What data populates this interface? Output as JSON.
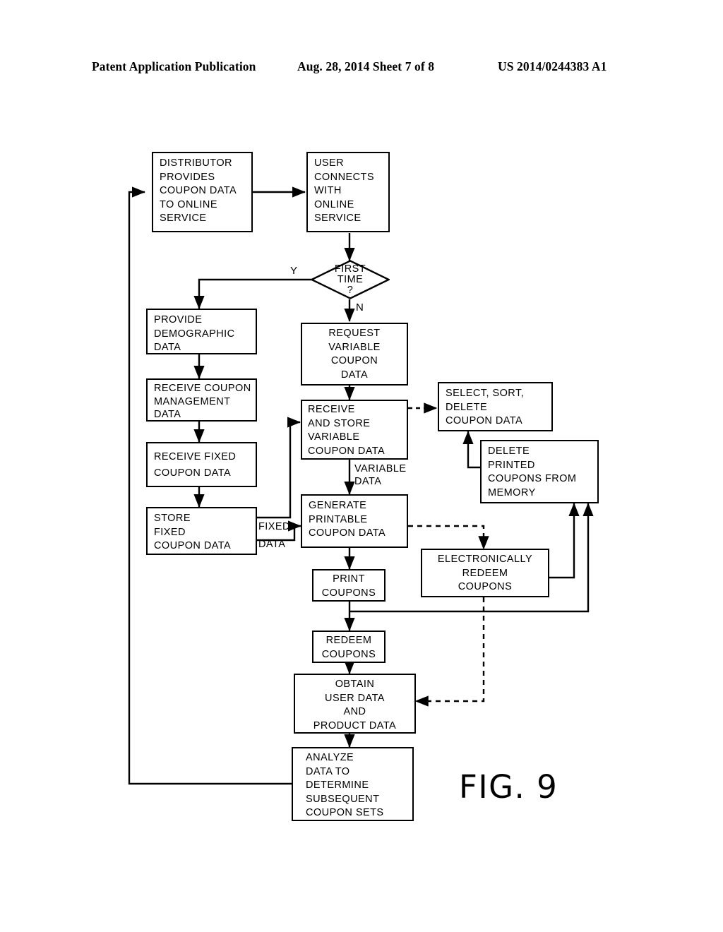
{
  "header": {
    "publication": "Patent Application Publication",
    "date_sheet": "Aug. 28, 2014  Sheet 7 of 8",
    "patent_number": "US 2014/0244383 A1"
  },
  "figure": {
    "caption": "FIG. 9",
    "type": "flowchart"
  },
  "nodes": {
    "distributor": {
      "lines": [
        "DISTRIBUTOR",
        "PROVIDES",
        "COUPON DATA",
        "TO ONLINE",
        "SERVICE"
      ]
    },
    "user_connects": {
      "lines": [
        "USER",
        "CONNECTS",
        "WITH",
        "ONLINE",
        "SERVICE"
      ]
    },
    "first_time": {
      "lines": [
        "FIRST",
        "TIME",
        "?"
      ]
    },
    "provide_demographic": {
      "lines": [
        "PROVIDE",
        "DEMOGRAPHIC",
        "DATA"
      ]
    },
    "receive_coupon_mgmt": {
      "lines": [
        "RECEIVE  COUPON",
        "MANAGEMENT",
        "DATA"
      ]
    },
    "receive_fixed": {
      "lines": [
        "RECEIVE FIXED",
        "COUPON DATA"
      ]
    },
    "store_fixed": {
      "lines": [
        "STORE",
        "FIXED",
        "COUPON DATA"
      ]
    },
    "request_variable": {
      "lines": [
        "REQUEST",
        "VARIABLE",
        "COUPON",
        "DATA"
      ]
    },
    "receive_store_variable": {
      "lines": [
        "RECEIVE",
        "AND STORE",
        "VARIABLE",
        "COUPON DATA"
      ]
    },
    "select_sort_delete": {
      "lines": [
        "SELECT, SORT,",
        "DELETE",
        "COUPON DATA"
      ]
    },
    "delete_printed": {
      "lines": [
        "DELETE",
        "PRINTED",
        "COUPONS FROM",
        "MEMORY"
      ]
    },
    "generate_printable": {
      "lines": [
        "GENERATE",
        "PRINTABLE",
        "COUPON DATA"
      ]
    },
    "electronically_redeem": {
      "lines": [
        "ELECTRONICALLY",
        "REDEEM",
        "COUPONS"
      ]
    },
    "print_coupons": {
      "lines": [
        "PRINT",
        "COUPONS"
      ]
    },
    "redeem_coupons": {
      "lines": [
        "REDEEM",
        "COUPONS"
      ]
    },
    "obtain_user_data": {
      "lines": [
        "OBTAIN",
        "USER DATA",
        "AND",
        "PRODUCT DATA"
      ]
    },
    "analyze_data": {
      "lines": [
        "ANALYZE",
        "DATA TO",
        "DETERMINE",
        "SUBSEQUENT",
        "COUPON SETS"
      ]
    }
  },
  "edge_labels": {
    "yes": "Y",
    "no": "N",
    "fixed": "FIXED",
    "fixed_data": "DATA",
    "variable": "VARIABLE",
    "variable_data": "DATA"
  },
  "colors": {
    "ink": "#000000",
    "paper": "#ffffff"
  }
}
